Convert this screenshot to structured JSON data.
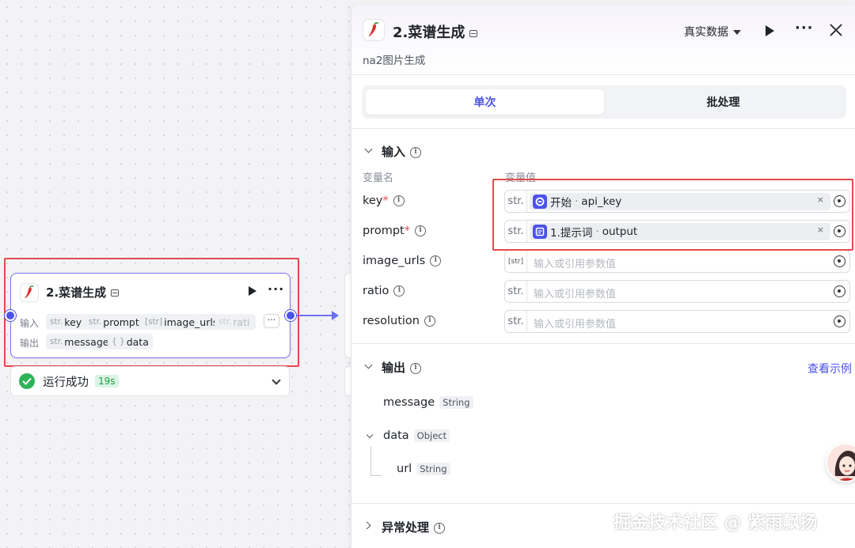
{
  "node": {
    "title": "2.菜谱生成",
    "input_label": "输入",
    "output_label": "输出",
    "inputs": [
      {
        "type": "str.",
        "name": "key"
      },
      {
        "type": "str.",
        "name": "prompt"
      },
      {
        "type": "[str]",
        "name": "image_urls"
      },
      {
        "type": "str.",
        "name": "rati"
      }
    ],
    "more": "···",
    "outputs": [
      {
        "type": "str.",
        "name": "message"
      },
      {
        "type": "{ }",
        "name": "data"
      }
    ],
    "status": "运行成功",
    "duration": "19s"
  },
  "panel": {
    "title": "2.菜谱生成",
    "subtitle": "na2图片生成",
    "data_mode": "真实数据",
    "tabs": [
      "单次",
      "批处理"
    ],
    "input_section": "输入",
    "col_name": "变量名",
    "col_value": "变量值",
    "info_glyph": "i",
    "placeholder": "输入或引用参数值",
    "fields": [
      {
        "name": "key",
        "required": "*",
        "type": "str.",
        "ref_source": "开始",
        "ref_dot": "·",
        "ref_var": "api_key"
      },
      {
        "name": "prompt",
        "required": "*",
        "type": "str.",
        "ref_source": "1.提示词",
        "ref_dot": "·",
        "ref_var": "output"
      },
      {
        "name": "image_urls",
        "type": "[str]"
      },
      {
        "name": "ratio",
        "type": "str."
      },
      {
        "name": "resolution",
        "type": "str."
      }
    ],
    "clear_glyph": "×",
    "output_section": "输出",
    "view_example": "查看示例",
    "outputs": [
      {
        "name": "message",
        "type": "String"
      },
      {
        "name": "data",
        "type": "Object"
      },
      {
        "name": "url",
        "type": "String"
      }
    ],
    "error_section": "异常处理"
  },
  "watermark": "掘金技术社区 @ 紫雨飘扬",
  "colors": {
    "accent": "#4d53e8",
    "highlight": "#e5484d",
    "success": "#2fb35a"
  }
}
